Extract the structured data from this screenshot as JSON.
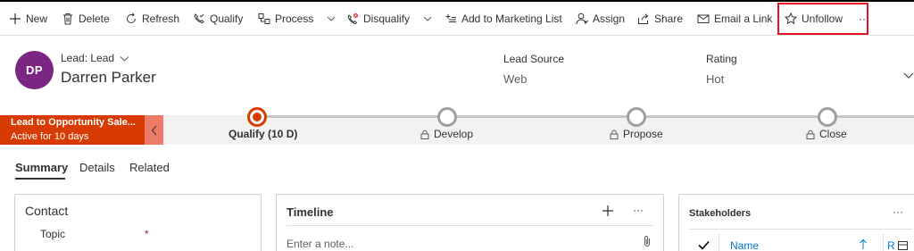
{
  "commands": [
    {
      "id": "new",
      "label": "New",
      "icon": "plus-icon"
    },
    {
      "id": "delete",
      "label": "Delete",
      "icon": "trash-icon"
    },
    {
      "id": "refresh",
      "label": "Refresh",
      "icon": "refresh-icon"
    },
    {
      "id": "qualify",
      "label": "Qualify",
      "icon": "phone-check-icon"
    },
    {
      "id": "process",
      "label": "Process",
      "icon": "process-icon"
    },
    {
      "id": "disqualify",
      "label": "Disqualify",
      "icon": "disqualify-icon"
    },
    {
      "id": "add_to_marketing_list",
      "label": "Add to Marketing List",
      "icon": "add-list-icon"
    },
    {
      "id": "assign",
      "label": "Assign",
      "icon": "person-icon"
    },
    {
      "id": "share",
      "label": "Share",
      "icon": "share-icon"
    },
    {
      "id": "email_link",
      "label": "Email a Link",
      "icon": "email-icon"
    },
    {
      "id": "unfollow",
      "label": "Unfollow",
      "icon": "star-icon"
    },
    {
      "id": "more",
      "label": "···",
      "icon": "more-icon"
    }
  ],
  "header": {
    "avatar_initials": "DP",
    "avatar_color": "#7a2682",
    "entity_label": "Lead: Lead",
    "record_name": "Darren Parker",
    "fields": [
      {
        "label": "Lead Source",
        "value": "Web"
      },
      {
        "label": "Rating",
        "value": "Hot"
      }
    ]
  },
  "bpf": {
    "process_name": "Lead to Opportunity Sale...",
    "active_duration": "Active for 10 days",
    "accent": "#d83b01",
    "stages": [
      {
        "label": "Qualify  (10 D)",
        "active": true,
        "locked": false
      },
      {
        "label": "Develop",
        "active": false,
        "locked": true
      },
      {
        "label": "Propose",
        "active": false,
        "locked": true
      },
      {
        "label": "Close",
        "active": false,
        "locked": true
      }
    ]
  },
  "tabs": [
    {
      "label": "Summary",
      "active": true
    },
    {
      "label": "Details",
      "active": false
    },
    {
      "label": "Related",
      "active": false
    }
  ],
  "contact_section": {
    "title": "Contact",
    "topic_label": "Topic",
    "required_marker": "*"
  },
  "timeline": {
    "title": "Timeline",
    "add_label": "+",
    "more_label": "···",
    "note_placeholder": "Enter a note..."
  },
  "stakeholders": {
    "title": "Stakeholders",
    "more_label": "···",
    "name_column": "Name",
    "second_column": "R"
  }
}
